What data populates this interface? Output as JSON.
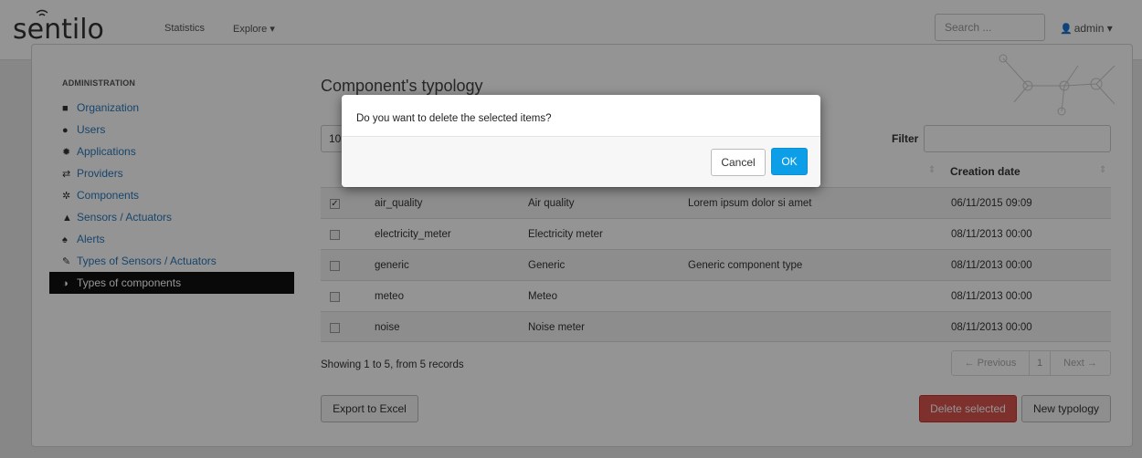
{
  "navbar": {
    "brand": "sentilo",
    "links": [
      "Statistics",
      "Explore"
    ],
    "search_placeholder": "Search ...",
    "user": "admin"
  },
  "sidebar": {
    "heading": "ADMINISTRATION",
    "items": [
      {
        "label": "Organization",
        "icon": "briefcase-icon"
      },
      {
        "label": "Users",
        "icon": "user-icon"
      },
      {
        "label": "Applications",
        "icon": "gear-icon"
      },
      {
        "label": "Providers",
        "icon": "exchange-icon"
      },
      {
        "label": "Components",
        "icon": "cogs-icon"
      },
      {
        "label": "Sensors / Actuators",
        "icon": "beaker-icon"
      },
      {
        "label": "Alerts",
        "icon": "bell-icon"
      },
      {
        "label": "Types of Sensors / Actuators",
        "icon": "wrench-icon"
      },
      {
        "label": "Types of components",
        "icon": "contrast-icon"
      }
    ],
    "active_index": 8
  },
  "main": {
    "title": "Component's typology",
    "page_size": "10",
    "filter_label": "Filter",
    "columns": [
      "Creation date"
    ],
    "rows": [
      {
        "id": "air_quality",
        "name": "Air quality",
        "description": "Lorem ipsum dolor si amet",
        "date": "06/11/2015 09:09",
        "checked": true
      },
      {
        "id": "electricity_meter",
        "name": "Electricity meter",
        "description": "",
        "date": "08/11/2013 00:00",
        "checked": false
      },
      {
        "id": "generic",
        "name": "Generic",
        "description": "Generic component type",
        "date": "08/11/2013 00:00",
        "checked": false
      },
      {
        "id": "meteo",
        "name": "Meteo",
        "description": "",
        "date": "08/11/2013 00:00",
        "checked": false
      },
      {
        "id": "noise",
        "name": "Noise meter",
        "description": "",
        "date": "08/11/2013 00:00",
        "checked": false
      }
    ],
    "info": "Showing 1 to 5, from 5 records",
    "pager": {
      "prev": "← Previous",
      "page": "1",
      "next": "Next →"
    },
    "export_button": "Export to Excel",
    "delete_button": "Delete selected",
    "new_button": "New typology"
  },
  "modal": {
    "message": "Do you want to delete the selected items?",
    "cancel": "Cancel",
    "ok": "OK"
  },
  "colors": {
    "accent": "#0d9ee8",
    "danger": "#d9534f",
    "link": "#2a77b8",
    "active_nav": "#111111"
  }
}
